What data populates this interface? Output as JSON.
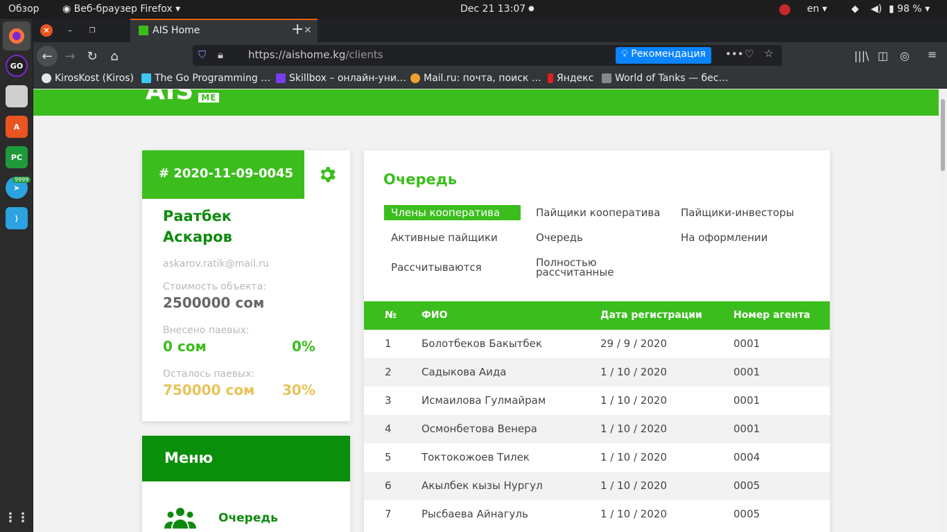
{
  "os": {
    "activities": "Обзор",
    "app_name": "Веб-браузер Firefox",
    "clock": "Dec 21  13:07",
    "language": "en",
    "battery": "98 %",
    "dock_badge": "9999"
  },
  "browser": {
    "tab_title": "AIS Home",
    "url_host": "https://aishome.kg",
    "url_path": "/clients",
    "recommend_label": "Рекомендация",
    "bookmarks": [
      {
        "label": "KirosKost (Kiros)",
        "color": "#e6e6e6"
      },
      {
        "label": "The Go Programming …",
        "color": "#3cc8f0"
      },
      {
        "label": "Skillbox – онлайн-уни…",
        "color": "#7a3cf0"
      },
      {
        "label": "Mail.ru: почта, поиск …",
        "color": "#f0a030"
      },
      {
        "label": "Яндекс",
        "color": "#e02020"
      },
      {
        "label": "World of Tanks — бес…",
        "color": "#888888"
      }
    ]
  },
  "site": {
    "logo": "AIS",
    "logo_badge": "ME"
  },
  "profile": {
    "id": "# 2020-11-09-0045",
    "first_name": "Раатбек",
    "last_name": "Аскаров",
    "email": "askarov.ratik@mail.ru",
    "cost_label": "Стоимость объекта:",
    "cost_value": "2500000 сом",
    "paid_label": "Внесено паевых:",
    "paid_value": "0 сом",
    "paid_percent": "0%",
    "left_label": "Осталось паевых:",
    "left_value": "750000 сом",
    "left_percent": "30%"
  },
  "menu": {
    "title": "Меню",
    "items": [
      {
        "label": "Очередь"
      }
    ]
  },
  "queue": {
    "title": "Очередь",
    "filters": [
      "Члены кооператива",
      "Пайщики кооператива",
      "Пайщики-инвесторы",
      "Активные пайщики",
      "Очередь",
      "На оформлении",
      "Рассчитываются",
      "Полностью рассчитанные"
    ],
    "columns": [
      "№",
      "ФИО",
      "Дата регистрации",
      "Номер агента"
    ],
    "rows": [
      [
        "1",
        "Болотбеков Бакытбек",
        "29 / 9 / 2020",
        "0001"
      ],
      [
        "2",
        "Садыкова Аида",
        "1 / 10 / 2020",
        "0001"
      ],
      [
        "3",
        "Исмаилова Гулмайрам",
        "1 / 10 / 2020",
        "0001"
      ],
      [
        "4",
        "Осмонбетова Венера",
        "1 / 10 / 2020",
        "0001"
      ],
      [
        "5",
        "Токтокожоев Тилек",
        "1 / 10 / 2020",
        "0004"
      ],
      [
        "6",
        "Акылбек кызы Нургул",
        "1 / 10 / 2020",
        "0005"
      ],
      [
        "7",
        "Рысбаева Айнагуль",
        "1 / 10 / 2020",
        "0005"
      ]
    ]
  },
  "colors": {
    "brand_green": "#3bbe1d",
    "dark_green": "#0a8f0a",
    "gold": "#e8c35a"
  }
}
